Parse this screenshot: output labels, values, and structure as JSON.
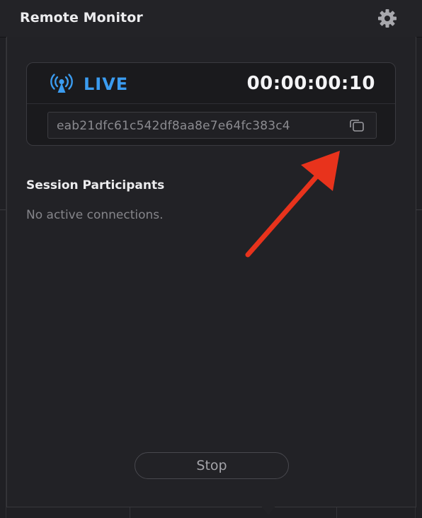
{
  "header": {
    "title": "Remote Monitor",
    "settings_icon": "gear-icon"
  },
  "live": {
    "status": "LIVE",
    "status_icon": "broadcast-icon",
    "status_color": "#3b9cf0",
    "timer": "00:00:00:10",
    "session_id": "eab21dfc61c542df8aa8e7e64fc383c4",
    "copy_icon": "copy-icon"
  },
  "participants": {
    "title": "Session Participants",
    "empty_message": "No active connections."
  },
  "actions": {
    "stop_label": "Stop"
  },
  "annotation": {
    "arrow_color": "#e8331c",
    "icon": "arrow-annotation"
  }
}
